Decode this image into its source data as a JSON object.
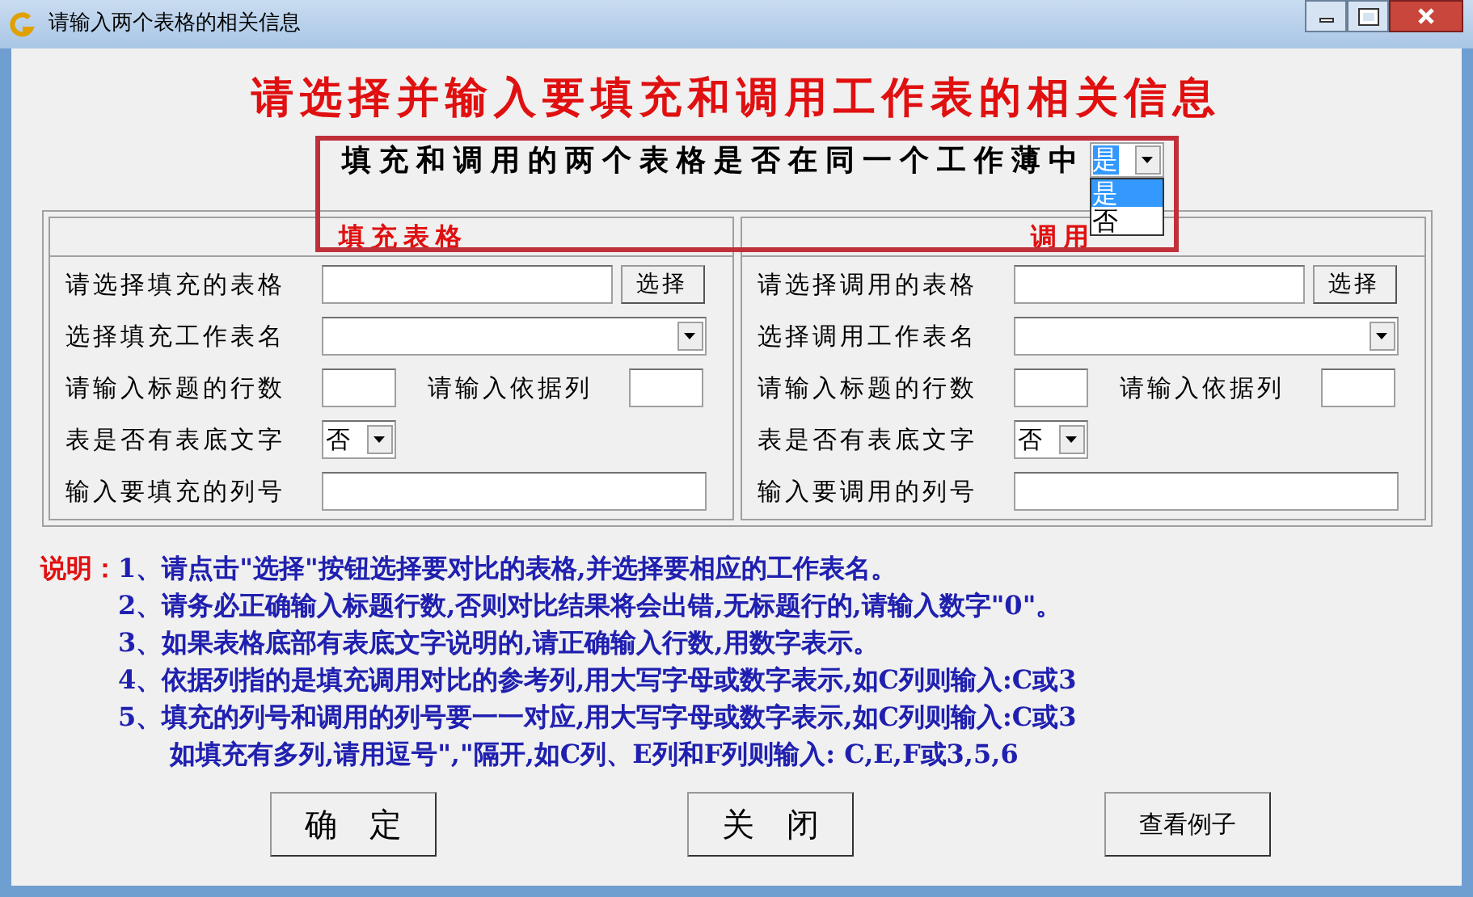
{
  "window": {
    "title": "请输入两个表格的相关信息"
  },
  "header": "请选择并输入要填充和调用工作表的相关信息",
  "same_workbook": {
    "label": "填充和调用的两个表格是否在同一个工作薄中",
    "value": "是",
    "dropdown": {
      "expanded": true,
      "options": [
        {
          "label": "是",
          "selected": true
        },
        {
          "label": "否",
          "selected": false
        }
      ]
    }
  },
  "groups": [
    {
      "title": "填充表格",
      "rows": [
        {
          "kind": "file",
          "label": "请选择填充的表格",
          "button": "选择"
        },
        {
          "kind": "combo",
          "label": "选择填充工作表名"
        },
        {
          "kind": "pair",
          "label": "请输入标题的行数",
          "label2": "请输入依据列"
        },
        {
          "kind": "select",
          "label": "表是否有表底文字",
          "value": "否"
        },
        {
          "kind": "text",
          "label": "输入要填充的列号"
        }
      ]
    },
    {
      "title": "调用",
      "rows": [
        {
          "kind": "file",
          "label": "请选择调用的表格",
          "button": "选择"
        },
        {
          "kind": "combo",
          "label": "选择调用工作表名"
        },
        {
          "kind": "pair",
          "label": "请输入标题的行数",
          "label2": "请输入依据列"
        },
        {
          "kind": "select",
          "label": "表是否有表底文字",
          "value": "否"
        },
        {
          "kind": "text",
          "label": "输入要调用的列号"
        }
      ]
    }
  ],
  "notes": {
    "label": "说明：",
    "lines": [
      "1、请点击\"选择\"按钮选择要对比的表格,并选择要相应的工作表名。",
      "2、请务必正确输入标题行数,否则对比结果将会出错,无标题行的,请输入数字\"0\"。",
      "3、如果表格底部有表底文字说明的,请正确输入行数,用数字表示。",
      "4、依据列指的是填充调用对比的参考列,用大写字母或数字表示,如C列则输入:C或3",
      "5、填充的列号和调用的列号要一一对应,用大写字母或数字表示,如C列则输入:C或3",
      "如填充有多列,请用逗号\",\"隔开,如C列、E列和F列则输入: C,E,F或3,5,6"
    ]
  },
  "buttons": [
    {
      "label": "确　定",
      "kind": "spaced"
    },
    {
      "label": "关　闭",
      "kind": "spaced"
    },
    {
      "label": "查看例子",
      "kind": "plain"
    }
  ]
}
